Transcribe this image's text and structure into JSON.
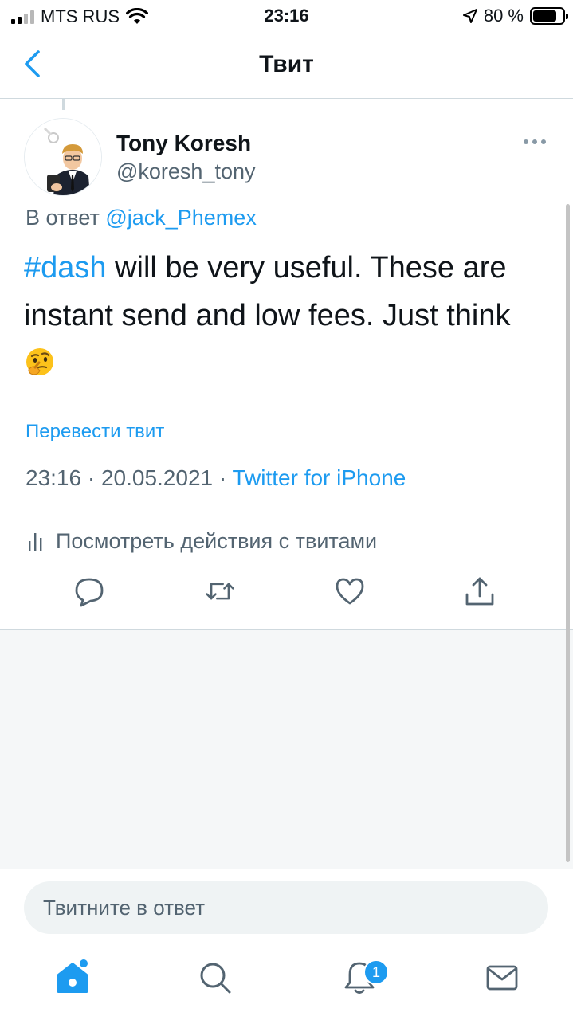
{
  "status_bar": {
    "carrier": "MTS RUS",
    "time": "23:16",
    "battery_percent": "80 %",
    "battery_level": 0.8
  },
  "header": {
    "title": "Твит"
  },
  "tweet": {
    "author_name": "Tony Koresh",
    "author_handle": "@koresh_tony",
    "reply_prefix": "В ответ ",
    "reply_mention": "@jack_Phemex",
    "text_hashtag": "#dash",
    "text_body": " will be very useful. These are instant send and low fees. Just think ",
    "emoji": "thinking-face",
    "translate_label": "Перевести твит",
    "timestamp": "23:16 · 20.05.2021 · ",
    "source": "Twitter for iPhone",
    "activity_label": "Посмотреть действия с твитами"
  },
  "compose": {
    "placeholder": "Твитните в ответ"
  },
  "tab_bar": {
    "notification_count": "1"
  },
  "colors": {
    "accent": "#1d9bf0",
    "secondary_text": "#536471",
    "divider": "#cfd9de"
  }
}
